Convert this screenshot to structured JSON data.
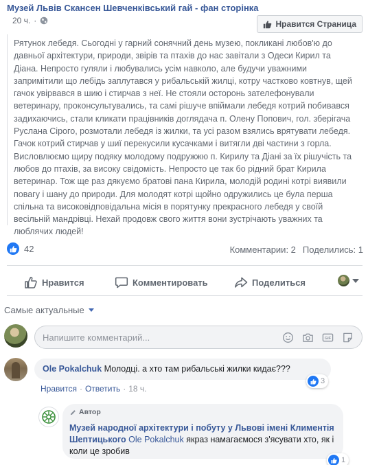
{
  "post": {
    "page_name": "Музей Львів Скансен Шевченківський гай - фан сторінка",
    "time": "20 ч.",
    "like_page_label": "Нравится Страница",
    "text": "Рятунок лебедя. Сьогодні у гарний сонячний день музею, покликані любов'ю до давньої архітектури, природи, звірів та птахів до нас завітали з Одеси Кирил та Діана. Непросто гуляли і любувались усім навколо, але будучи уважними запримітили що лебідь заплутався у рибальській жилці, котру частково ковтнув, щей гачок увірвався в шию і стирчав з неї. Не стояли осторонь зателефонували ветеринару, проконсультувались, та самі рішуче впіймали лебедя котрий побивався задихаючись, стали кликати працівників доглядача п. Олену Попович, гол. зберігача Руслана Сірого, розмотали лебедя із жилки, та усі разом взялись врятувати лебедя. Гачок котрий стирчав у шиї перекусили кусачками і витягли дві частини з горла. Висловлюємо щиру подяку молодому подружжю п. Кирилу та Діані за їх рішучість та любов до птахів, за високу свідомість. Непросто це так бо рідний брат Кирила ветеринар. Тож ще раз дякуємо братові пана Кирила, молодій родині котрі виявили повагу і шану до природи. Для молодят котрі щойно одружились це була перша спільна та високовідповідальна місія в порятунку прекрасного лебедя у своїй весільній мандрівці. Нехай продовж свого життя вони зустрічають уважних та люблячих людей!",
    "reactions_count": "42",
    "comments_count": "Комментарии: 2",
    "shares_count": "Поделились: 1"
  },
  "actions": {
    "like": "Нравится",
    "comment": "Комментировать",
    "share": "Поделиться"
  },
  "comments_section": {
    "sort_label": "Самые актуальные",
    "composer_placeholder": "Напишите комментарий..."
  },
  "comments": [
    {
      "author": "Ole Pokalchuk",
      "text": "Молодці. а хто там рибальські жилки кидає???",
      "reactions": "3",
      "like_label": "Нравится",
      "reply_label": "Ответить",
      "time": "18 ч."
    }
  ],
  "reply": {
    "badge": "Автор",
    "author": "Музей народної архітектури і побуту у Львові імені Климентія Шептицького",
    "mention": "Ole Pokalchuk",
    "text": "якраз намагаємося з'ясувати хто, як і коли це зробив",
    "reactions": "1"
  },
  "colors": {
    "link": "#385898",
    "like_blue": "#2078f4",
    "muted": "#616770"
  }
}
